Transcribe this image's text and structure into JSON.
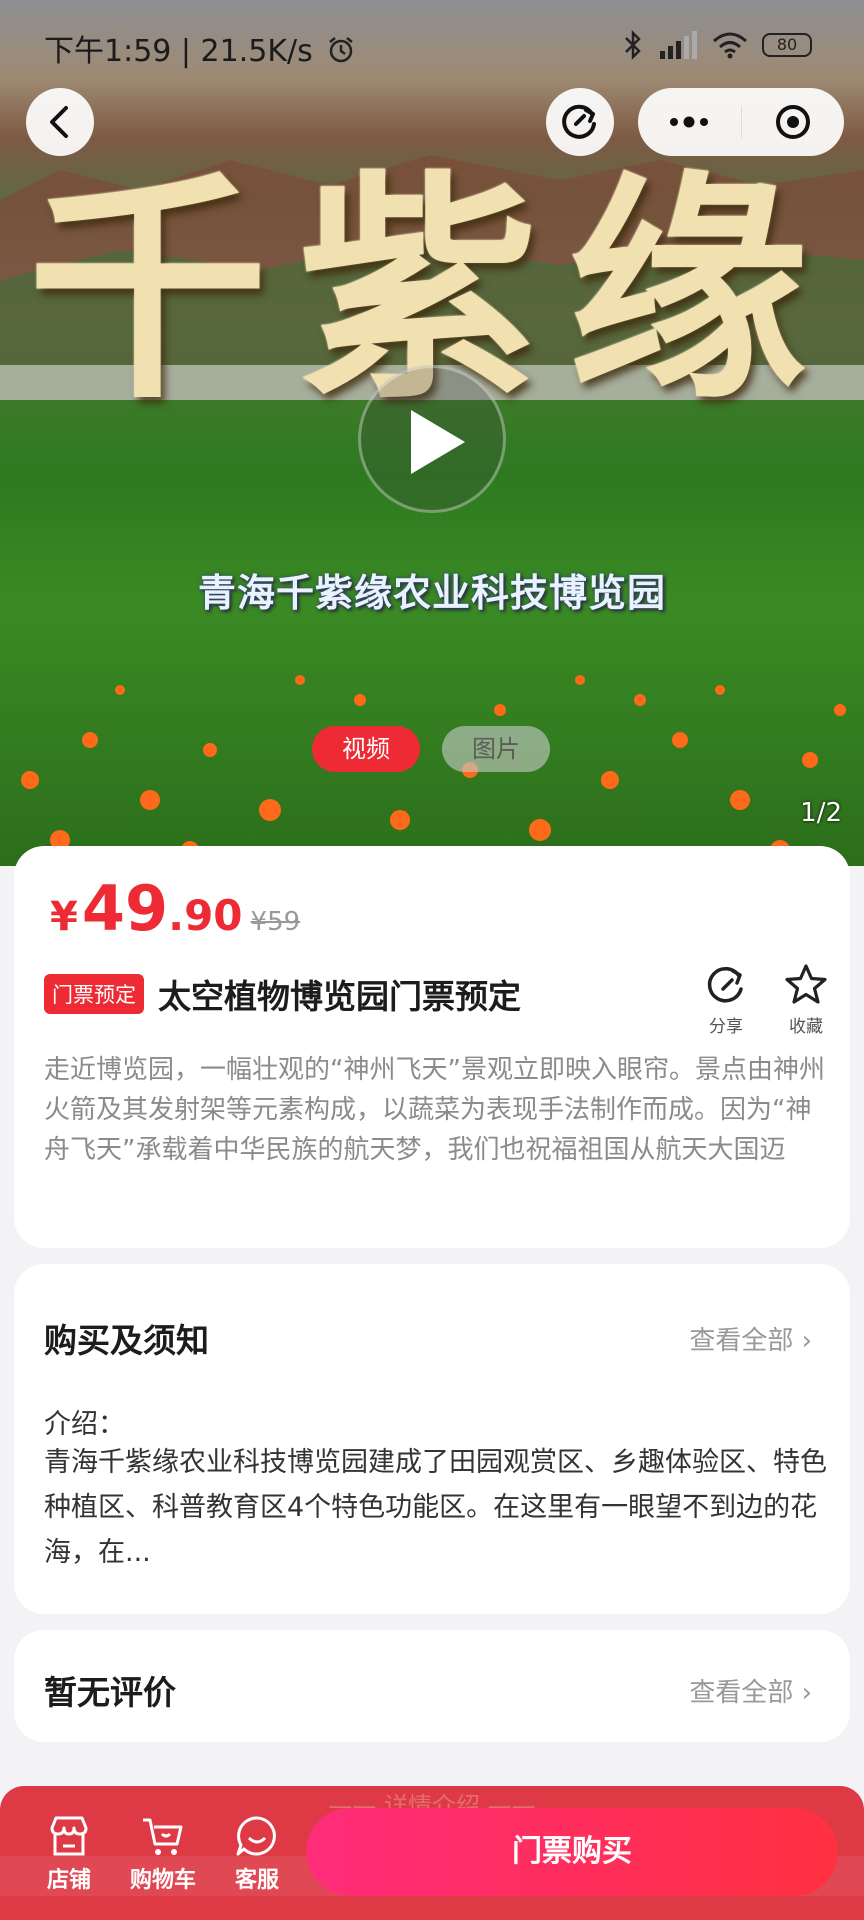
{
  "status": {
    "time": "下午1:59 | 21.5K/s",
    "battery": "80"
  },
  "hero": {
    "title_art": "千紫缘",
    "subtitle": "青海千紫缘农业科技博览园",
    "tabs": [
      {
        "label": "视频",
        "active": true
      },
      {
        "label": "图片",
        "active": false
      }
    ],
    "counter": "1/2"
  },
  "product": {
    "price_symbol": "¥",
    "price_integer": "49",
    "price_decimal": ".90",
    "original_price": "¥59",
    "tag": "门票预定",
    "title": "太空植物博览园门票预定",
    "share_label": "分享",
    "favorite_label": "收藏",
    "description": "走近博览园，一幅壮观的“神州飞天”景观立即映入眼帘。景点由神州火箭及其发射架等元素构成，以蔬菜为表现手法制作而成。因为“神舟飞天”承载着中华民族的航天梦，我们也祝福祖国从航天大国迈"
  },
  "notice": {
    "title": "购买及须知",
    "more": "查看全部 ›",
    "label": "介绍：",
    "text": "青海千紫缘农业科技博览园建成了田园观赏区、乡趣体验区、特色种植区、科普教育区4个特色功能区。在这里有一眼望不到边的花海，在..."
  },
  "review": {
    "title": "暂无评价",
    "more": "查看全部 ›"
  },
  "bottom_bar": {
    "ghost_text": "—— 详情介绍 ——",
    "store": "店铺",
    "cart": "购物车",
    "service": "客服",
    "buy": "门票购买"
  },
  "colors": {
    "accent": "#ee2a35",
    "buy_gradient_start": "#ff2c7a",
    "buy_gradient_end": "#ff3040"
  }
}
